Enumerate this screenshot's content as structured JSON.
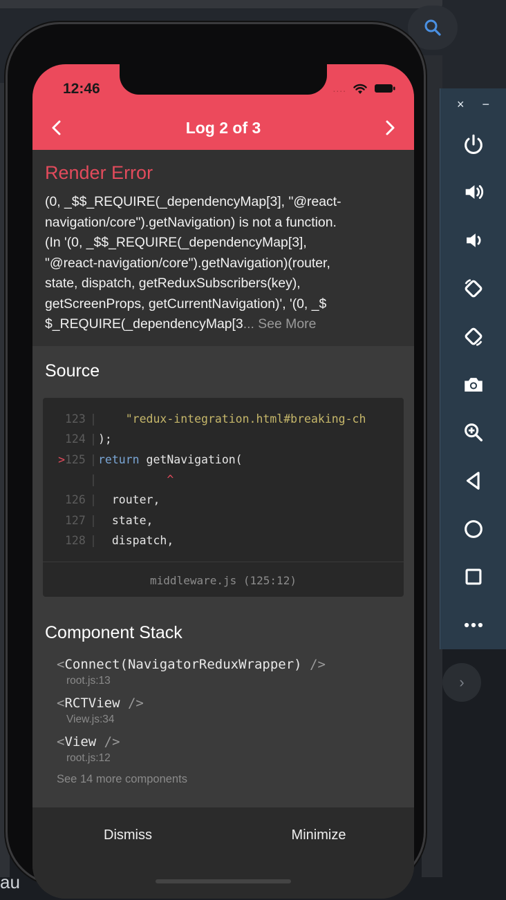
{
  "colors": {
    "header_bg": "#ec4a5c",
    "error_title": "#e34b5c",
    "panel_bg": "#2a3b4a"
  },
  "status_bar": {
    "time": "12:46",
    "signal": "....",
    "icons": [
      "wifi-icon",
      "battery-icon"
    ]
  },
  "header": {
    "title": "Log 2 of 3",
    "prev_icon": "chevron-left-icon",
    "next_icon": "chevron-right-icon"
  },
  "error": {
    "title": "Render Error",
    "message_lines": [
      "(0, _$$_REQUIRE(_dependencyMap[3], \"@react-",
      "navigation/core\").getNavigation) is not a function.",
      "(In '(0, _$$_REQUIRE(_dependencyMap[3],",
      "\"@react-navigation/core\").getNavigation)(router,",
      "state, dispatch, getReduxSubscribers(key),",
      "getScreenProps, getCurrentNavigation)', '(0, _$",
      "$_REQUIRE(_dependencyMap[3"
    ],
    "ellipsis": "...",
    "see_more": "See More"
  },
  "source": {
    "title": "Source",
    "lines": [
      {
        "mark": "",
        "num": "123",
        "pipe": "|",
        "text": "    \"redux-integration.html#breaking-ch"
      },
      {
        "mark": "",
        "num": "124",
        "pipe": "|",
        "text": ");"
      },
      {
        "mark": ">",
        "num": "125",
        "pipe": "|",
        "kw": "return",
        "text": " getNavigation("
      },
      {
        "mark": "",
        "num": "",
        "pipe": "|",
        "caret": "          ^"
      },
      {
        "mark": "",
        "num": "126",
        "pipe": "|",
        "text": "  router,"
      },
      {
        "mark": "",
        "num": "127",
        "pipe": "|",
        "text": "  state,"
      },
      {
        "mark": "",
        "num": "128",
        "pipe": "|",
        "text": "  dispatch,"
      }
    ],
    "file": "middleware.js (125:12)"
  },
  "component_stack": {
    "title": "Component Stack",
    "items": [
      {
        "open": "<",
        "name": "Connect(NavigatorReduxWrapper)",
        "close": " />",
        "file": "root.js:13"
      },
      {
        "open": "<",
        "name": "RCTView",
        "close": " />",
        "file": "View.js:34"
      },
      {
        "open": "<",
        "name": "View",
        "close": " />",
        "file": "root.js:12"
      }
    ],
    "more": "See 14 more components"
  },
  "footer": {
    "dismiss": "Dismiss",
    "minimize": "Minimize"
  },
  "emulator_panel": {
    "close": "×",
    "minimize": "−",
    "buttons": [
      "power-icon",
      "volume-up-icon",
      "volume-down-icon",
      "rotate-left-icon",
      "rotate-right-icon",
      "camera-icon",
      "zoom-icon",
      "back-icon",
      "home-icon",
      "overview-icon",
      "more-icon"
    ]
  },
  "background": {
    "partial_text": "au"
  }
}
